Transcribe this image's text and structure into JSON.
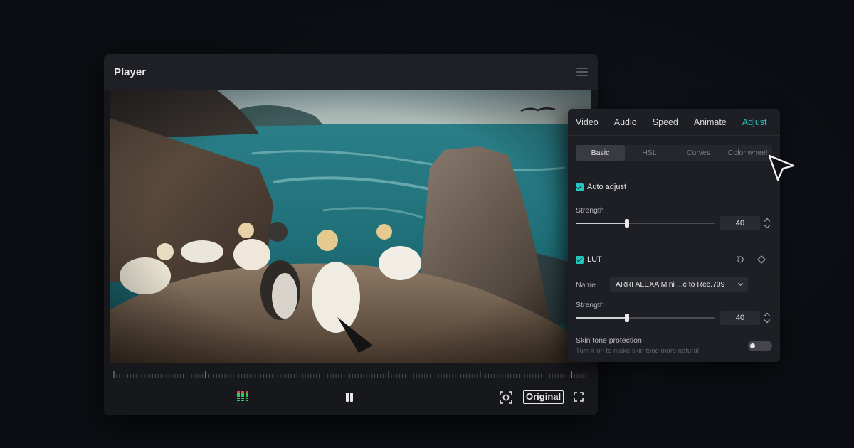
{
  "player": {
    "title": "Player",
    "controls": {
      "original_label": "Original"
    }
  },
  "panel": {
    "tabs": [
      "Video",
      "Audio",
      "Speed",
      "Animate",
      "Adjust"
    ],
    "active_tab": "Adjust",
    "subtabs": [
      "Basic",
      "HSL",
      "Curves",
      "Color wheel"
    ],
    "active_subtab": "Basic",
    "auto_adjust": {
      "label": "Auto adjust",
      "checked": true,
      "strength_label": "Strength",
      "strength_value": "40",
      "strength_fraction": 0.37
    },
    "lut": {
      "label": "LUT",
      "checked": true,
      "name_label": "Name",
      "name_value": "ARRI ALEXA Mini ...c to Rec.709",
      "strength_label": "Strength",
      "strength_value": "40",
      "strength_fraction": 0.37
    },
    "skin_tone": {
      "label": "Skin tone protection",
      "hint": "Turn it on to make skin tone more natural",
      "enabled": false
    }
  },
  "colors": {
    "accent": "#22c7bd",
    "panel_bg": "#1e1f24",
    "player_bg": "#17181c"
  },
  "icons": [
    "menu-icon",
    "audio-meter-icon",
    "pause-icon",
    "screenshot-icon",
    "fullscreen-icon",
    "reset-icon",
    "keyframe-icon",
    "cursor-arrow-icon"
  ]
}
